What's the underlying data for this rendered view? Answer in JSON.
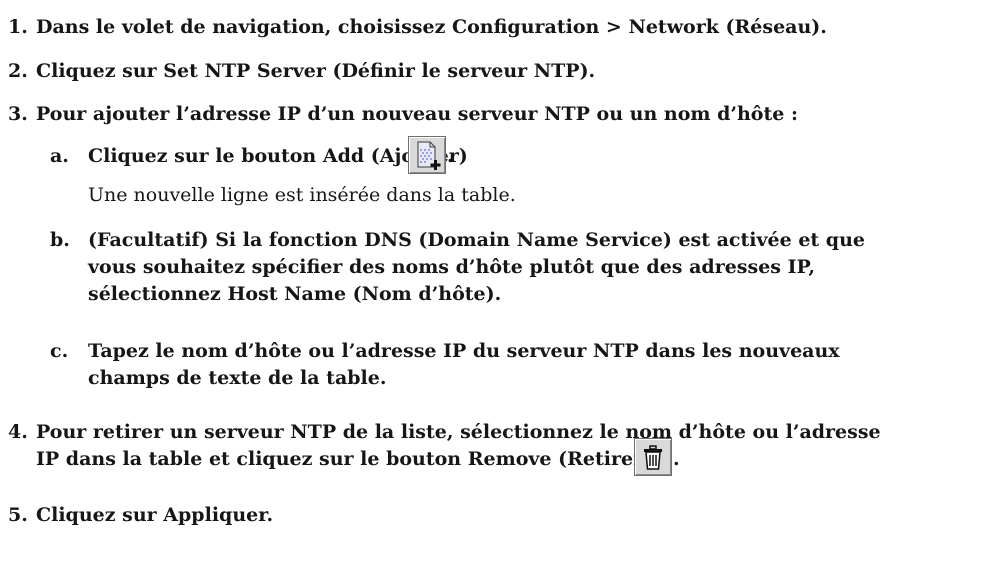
{
  "steps": [
    {
      "num": "1.",
      "text": "Dans le volet de navigation, choisissez Configuration > Network (Réseau)."
    },
    {
      "num": "2.",
      "text": "Cliquez sur Set NTP Server (Définir le serveur NTP)."
    },
    {
      "num": "3.",
      "text": "Pour ajouter l’adresse IP d’un nouveau serveur NTP ou un nom d’hôte :"
    },
    {
      "num": "4.",
      "line1": "Pour retirer un serveur NTP de la liste, sélectionnez le nom d’hôte ou l’adresse",
      "line2": "IP dans la table et cliquez sur le bouton Remove (Retirer).",
      "after_icon": "."
    },
    {
      "num": "5.",
      "text": "Cliquez sur Appliquer."
    }
  ],
  "substeps": [
    {
      "num": "a.",
      "text": "Cliquez sur le bouton Add (Ajouter)",
      "after_icon": ".",
      "note": "Une nouvelle ligne est insérée dans la table."
    },
    {
      "num": "b.",
      "line1": "(Facultatif) Si la fonction DNS (Domain Name Service) est activée et que",
      "line2": "vous souhaitez spécifier des noms d’hôte plutôt que des adresses IP,",
      "line3": "sélectionnez Host Name (Nom d’hôte)."
    },
    {
      "num": "c.",
      "line1": "Tapez le nom d’hôte ou l’adresse IP du serveur NTP dans les nouveaux",
      "line2": "champs de texte de la table."
    }
  ],
  "icons": {
    "add": "add-row-icon",
    "remove": "trash-icon"
  }
}
